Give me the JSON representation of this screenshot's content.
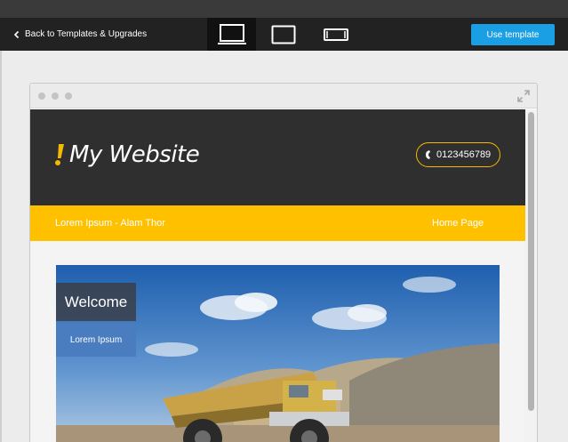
{
  "editor": {
    "back_label": "Back to Templates & Upgrades",
    "use_template_label": "Use template",
    "devices": [
      {
        "name": "desktop",
        "active": true
      },
      {
        "name": "tablet",
        "active": false
      },
      {
        "name": "mobile",
        "active": false
      }
    ],
    "accent_color": "#1a9ee4"
  },
  "site": {
    "logo_text": "My Website",
    "phone": "0123456789",
    "nav_brand": "Lorem Ipsum - Alam Thor",
    "nav_home": "Home Page",
    "hero_title": "Welcome",
    "hero_button": "Lorem Ipsum",
    "accent_color": "#ffc000",
    "header_color": "#2f2f2f"
  }
}
